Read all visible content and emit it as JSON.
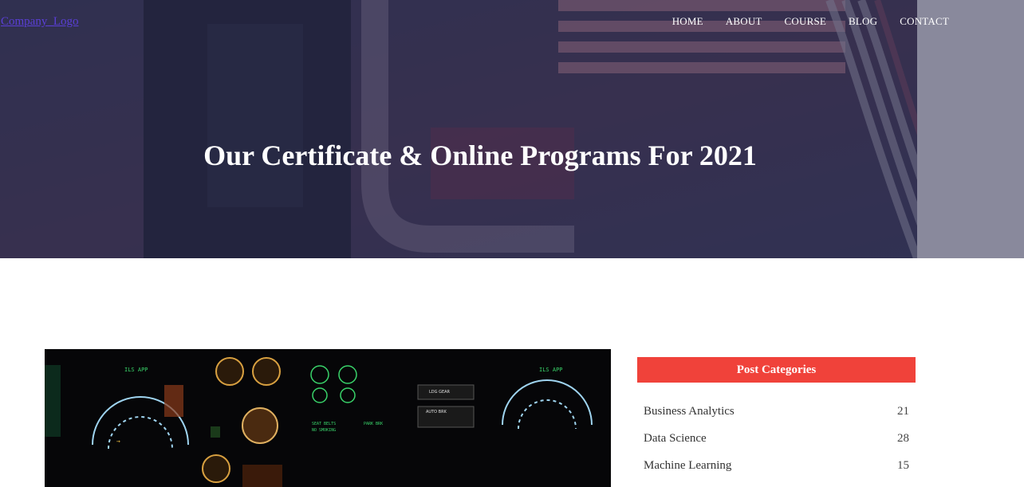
{
  "header": {
    "logo_text": "Company_Logo",
    "nav": [
      {
        "label": "HOME"
      },
      {
        "label": "ABOUT"
      },
      {
        "label": "COURSE"
      },
      {
        "label": "BLOG"
      },
      {
        "label": "CONTACT"
      }
    ]
  },
  "hero": {
    "title": "Our Certificate & Online Programs For 2021"
  },
  "sidebar": {
    "categories_title": "Post Categories",
    "categories": [
      {
        "name": "Business Analytics",
        "count": "21"
      },
      {
        "name": "Data Science",
        "count": "28"
      },
      {
        "name": "Machine Learning",
        "count": "15"
      }
    ]
  },
  "colors": {
    "accent": "#f0423a",
    "hero_overlay": "#28284b",
    "logo_link": "#5a3fd6"
  }
}
